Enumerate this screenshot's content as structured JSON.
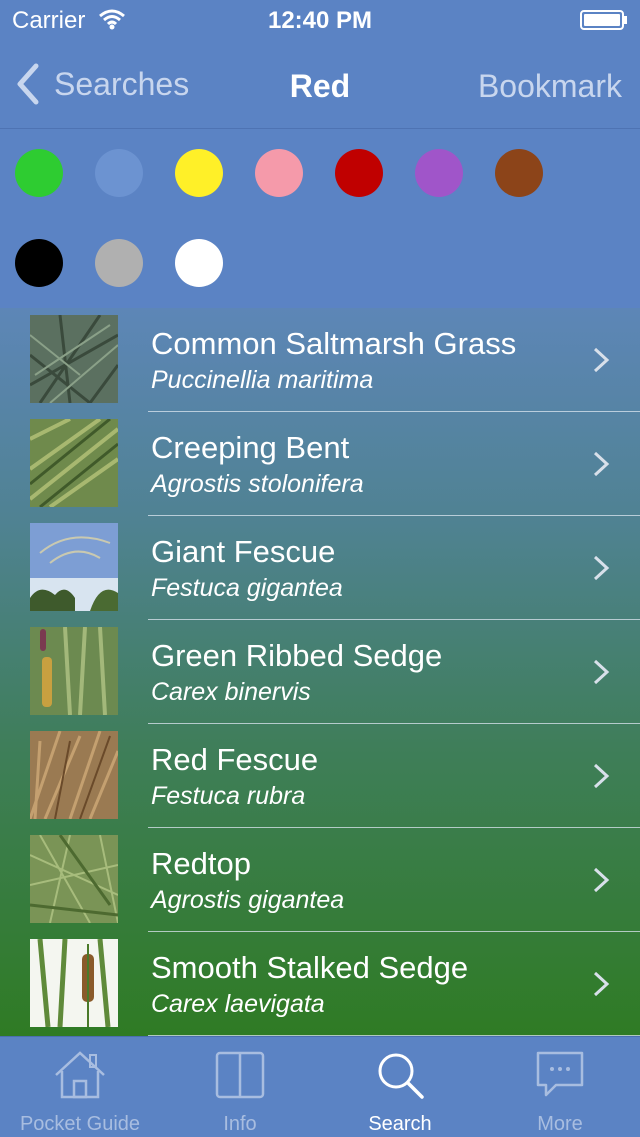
{
  "status_bar": {
    "carrier": "Carrier",
    "time": "12:40 PM"
  },
  "nav": {
    "back_label": "Searches",
    "title": "Red",
    "bookmark_label": "Bookmark"
  },
  "color_filter": [
    {
      "name": "green",
      "hex": "#2ecc31"
    },
    {
      "name": "blue",
      "hex": "#6c93d1"
    },
    {
      "name": "yellow",
      "hex": "#fff028"
    },
    {
      "name": "pink",
      "hex": "#f59aaa"
    },
    {
      "name": "red",
      "hex": "#c00000"
    },
    {
      "name": "purple",
      "hex": "#a055c9"
    },
    {
      "name": "brown",
      "hex": "#8c4419"
    },
    {
      "name": "black",
      "hex": "#000000"
    },
    {
      "name": "grey",
      "hex": "#b0b0b0"
    },
    {
      "name": "white",
      "hex": "#ffffff"
    }
  ],
  "species": [
    {
      "common": "Common Saltmarsh Grass",
      "latin": "Puccinellia maritima"
    },
    {
      "common": "Creeping Bent",
      "latin": "Agrostis stolonifera"
    },
    {
      "common": "Giant Fescue",
      "latin": "Festuca gigantea"
    },
    {
      "common": "Green Ribbed Sedge",
      "latin": "Carex binervis"
    },
    {
      "common": "Red Fescue",
      "latin": "Festuca rubra"
    },
    {
      "common": "Redtop",
      "latin": "Agrostis gigantea"
    },
    {
      "common": "Smooth Stalked Sedge",
      "latin": "Carex laevigata"
    }
  ],
  "tabs": [
    {
      "label": "Pocket Guide",
      "icon": "house-icon"
    },
    {
      "label": "Info",
      "icon": "book-icon"
    },
    {
      "label": "Search",
      "icon": "magnifier-icon"
    },
    {
      "label": "More",
      "icon": "speech-bubble-icon"
    }
  ]
}
